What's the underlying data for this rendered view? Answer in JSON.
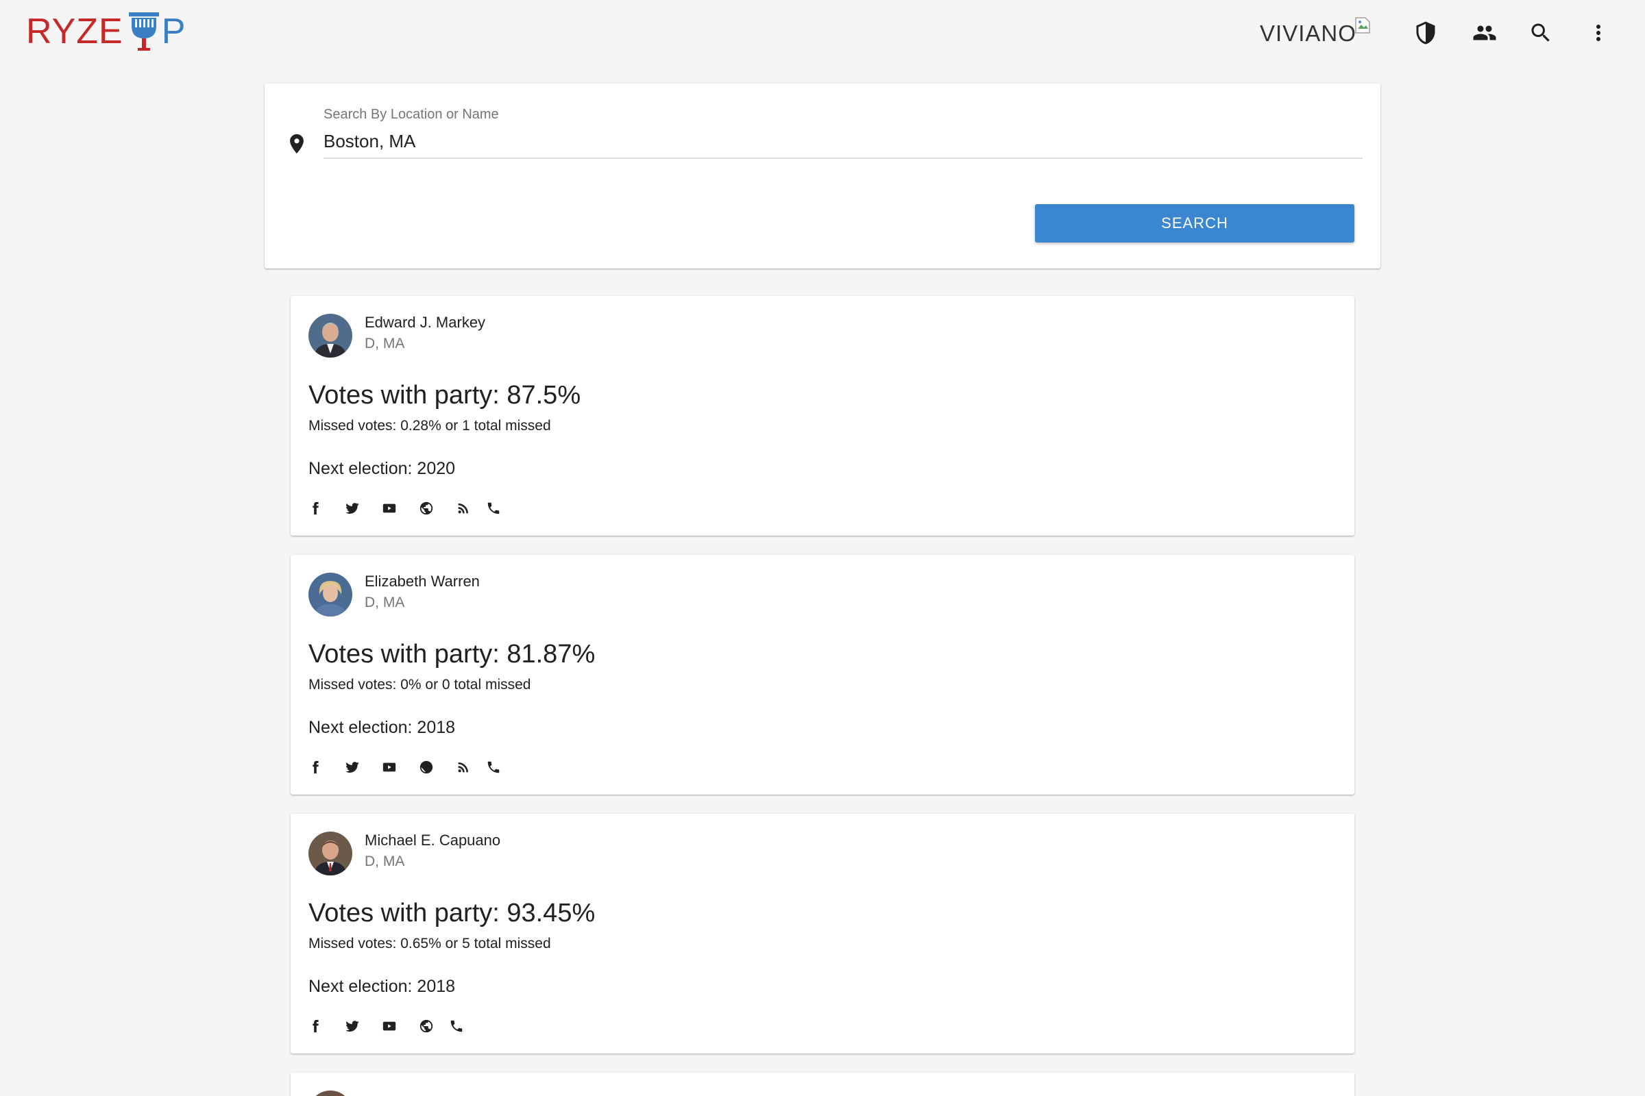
{
  "app": {
    "logo_left": "RYZE",
    "logo_right": "P",
    "username": "VIVIANO"
  },
  "toolbar": {
    "icons": [
      "shield-icon",
      "people-icon",
      "search-icon",
      "more-vert-icon"
    ]
  },
  "search": {
    "label": "Search By Location or Name",
    "value": "Boston, MA",
    "button_label": "SEARCH"
  },
  "reps": [
    {
      "name": "Edward J. Markey",
      "party": "D, MA",
      "votes_with_party": "Votes with party: 87.5%",
      "missed_votes": "Missed votes: 0.28% or 1 total missed",
      "next_election": "Next election: 2020",
      "links": [
        "facebook-icon",
        "twitter-icon",
        "youtube-icon",
        "website-icon",
        "rss-icon",
        "phone-icon"
      ]
    },
    {
      "name": "Elizabeth Warren",
      "party": "D, MA",
      "votes_with_party": "Votes with party: 81.87%",
      "missed_votes": "Missed votes: 0% or 0 total missed",
      "next_election": "Next election: 2018",
      "links": [
        "facebook-icon",
        "twitter-icon",
        "youtube-icon",
        "website-icon",
        "rss-icon",
        "phone-icon"
      ]
    },
    {
      "name": "Michael E. Capuano",
      "party": "D, MA",
      "votes_with_party": "Votes with party: 93.45%",
      "missed_votes": "Missed votes: 0.65% or 5 total missed",
      "next_election": "Next election: 2018",
      "links": [
        "facebook-icon",
        "twitter-icon",
        "youtube-icon",
        "website-icon",
        "phone-icon"
      ]
    }
  ],
  "colors": {
    "logo_red": "#c62828",
    "logo_blue": "#3a7fc4",
    "button_blue": "#3a86d0",
    "background": "#f5f5f5"
  }
}
